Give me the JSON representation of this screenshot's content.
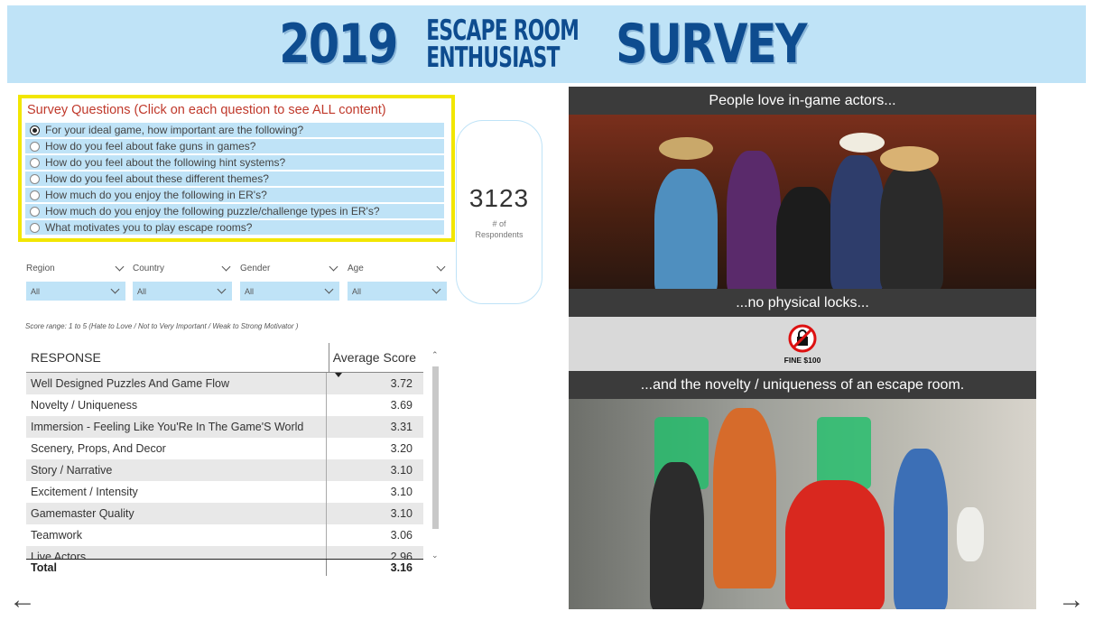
{
  "banner": {
    "year": "2019",
    "line1": "ESCAPE ROOM",
    "line2": "ENTHUSIAST",
    "survey": "SURVEY"
  },
  "questions": {
    "heading": "Survey Questions (Click on each question to see ALL content)",
    "items": [
      {
        "label": "For your ideal game, how important are the following?",
        "selected": true
      },
      {
        "label": "How do you feel about fake guns in games?",
        "selected": false
      },
      {
        "label": "How do you feel about the following hint systems?",
        "selected": false
      },
      {
        "label": "How do you feel about these different themes?",
        "selected": false
      },
      {
        "label": "How much do you enjoy the following in ER's?",
        "selected": false
      },
      {
        "label": "How much do you enjoy the following puzzle/challenge types in ER's?",
        "selected": false
      },
      {
        "label": "What motivates you to play escape rooms?",
        "selected": false
      }
    ]
  },
  "counter": {
    "value": "3123",
    "label_line1": "# of",
    "label_line2": "Respondents"
  },
  "filters": [
    {
      "label": "Region",
      "value": "All"
    },
    {
      "label": "Country",
      "value": "All"
    },
    {
      "label": "Gender",
      "value": "All"
    },
    {
      "label": "Age",
      "value": "All"
    }
  ],
  "score_range": "Score range: 1 to 5  (Hate to Love / Not to Very Important / Weak to Strong Motivator )",
  "table": {
    "headers": [
      "RESPONSE",
      "Average Score"
    ],
    "rows": [
      {
        "response": "Well Designed Puzzles And Game Flow",
        "score": "3.72"
      },
      {
        "response": "Novelty / Uniqueness",
        "score": "3.69"
      },
      {
        "response": "Immersion - Feeling Like You'Re In The Game'S World",
        "score": "3.31"
      },
      {
        "response": "Scenery, Props, And Decor",
        "score": "3.20"
      },
      {
        "response": "Story / Narrative",
        "score": "3.10"
      },
      {
        "response": "Excitement / Intensity",
        "score": "3.10"
      },
      {
        "response": "Gamemaster Quality",
        "score": "3.10"
      },
      {
        "response": "Teamwork",
        "score": "3.06"
      },
      {
        "response": "Live Actors",
        "score": "2.96"
      }
    ],
    "total_label": "Total",
    "total_value": "3.16"
  },
  "photos": {
    "caption1": "People love in-game actors...",
    "caption2": "...no physical locks...",
    "fine": "FINE $100",
    "caption3": "...and the novelty / uniqueness of an escape room."
  },
  "nav": {
    "prev": "←",
    "next": "→"
  }
}
